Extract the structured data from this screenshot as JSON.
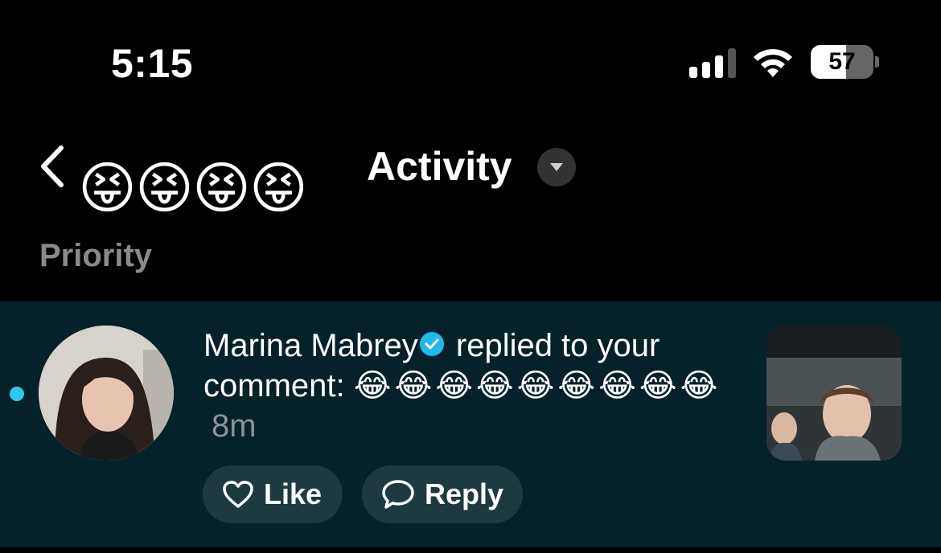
{
  "status_bar": {
    "time": "5:15",
    "battery_level": "57",
    "battery_fraction": 0.57
  },
  "header": {
    "back_icon": "chevron-left-icon",
    "emojis": "😝😝😝😝",
    "title": "Activity",
    "dropdown_icon": "caret-down-icon",
    "section_label": "Priority"
  },
  "notification": {
    "unread": true,
    "user_name": "Marina Mabrey",
    "verified": true,
    "action_text": " replied to your comment: ",
    "emojis": "😂😂😂😂😂😂😂😂😂",
    "time_ago": "8m",
    "like_label": "Like",
    "reply_label": "Reply"
  },
  "colors": {
    "background": "#000000",
    "card_background": "#05212a",
    "button_background": "#1e3a40",
    "accent": "#2ec7ef",
    "muted_text": "#8a8a8a"
  }
}
